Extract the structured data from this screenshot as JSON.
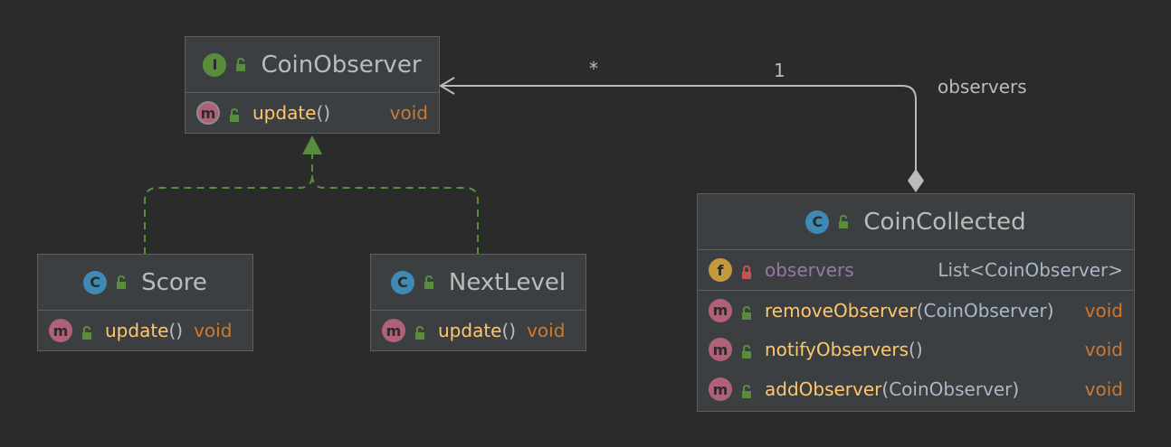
{
  "relations": {
    "composition": {
      "multiplicity_source": "*",
      "multiplicity_target": "1",
      "role": "observers"
    }
  },
  "classes": {
    "coin_observer": {
      "kind": "I",
      "name": "CoinObserver",
      "methods": [
        {
          "badge": "m",
          "name": "update",
          "params": "()",
          "type": "void"
        }
      ]
    },
    "score": {
      "kind": "C",
      "name": "Score",
      "methods": [
        {
          "badge": "m",
          "name": "update",
          "params": "()",
          "type": "void"
        }
      ]
    },
    "next_level": {
      "kind": "C",
      "name": "NextLevel",
      "methods": [
        {
          "badge": "m",
          "name": "update",
          "params": "()",
          "type": "void"
        }
      ]
    },
    "coin_collected": {
      "kind": "C",
      "name": "CoinCollected",
      "fields": [
        {
          "badge": "f",
          "name": "observers",
          "type": "List<CoinObserver>"
        }
      ],
      "methods": [
        {
          "badge": "m",
          "name": "removeObserver",
          "open": "(",
          "param": "CoinObserver",
          "close": ")",
          "type": "void"
        },
        {
          "badge": "m",
          "name": "notifyObservers",
          "open": "(",
          "param": "",
          "close": ")",
          "type": "void"
        },
        {
          "badge": "m",
          "name": "addObserver",
          "open": "(",
          "param": "CoinObserver",
          "close": ")",
          "type": "void"
        }
      ]
    }
  },
  "colors": {
    "background": "#2b2b2b",
    "box_fill": "#3c3f41",
    "implementation_arrow": "#598c3b",
    "association_line": "#bbbbbb"
  }
}
